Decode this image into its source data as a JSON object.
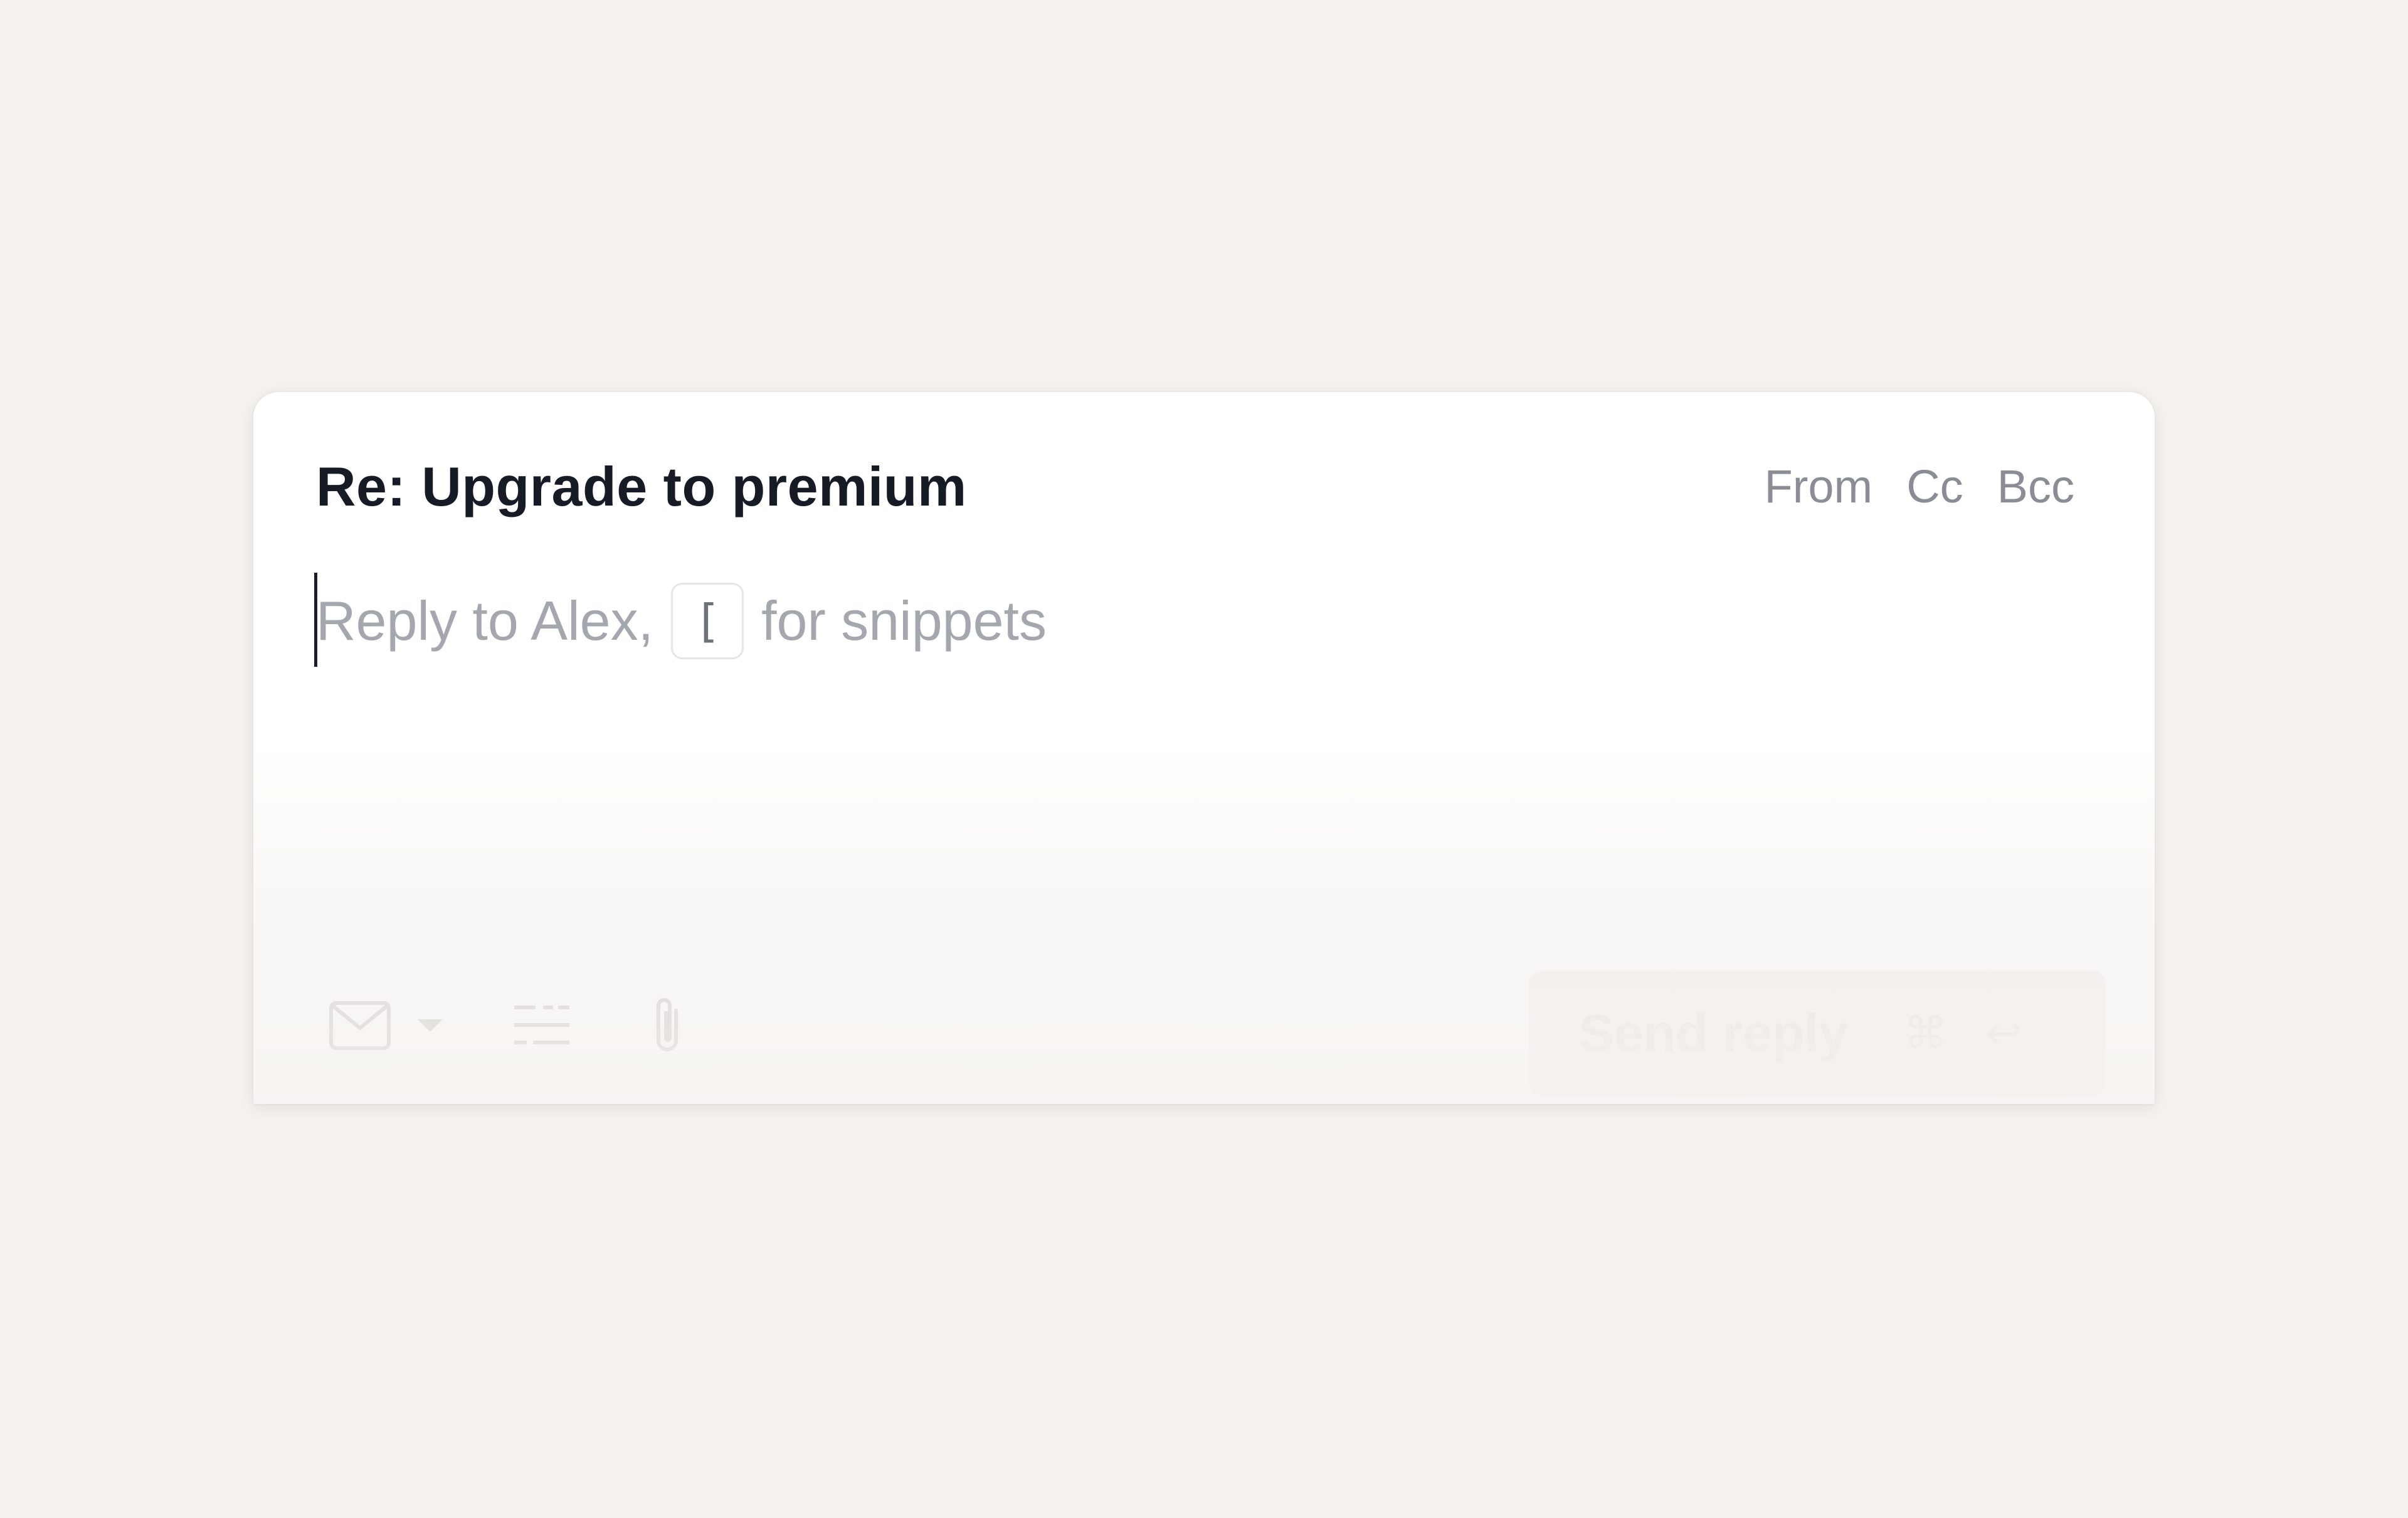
{
  "composer": {
    "subject": "Re: Upgrade to premium",
    "header_links": {
      "from": "From",
      "cc": "Cc",
      "bcc": "Bcc"
    },
    "placeholder": {
      "before": "Reply to Alex,",
      "key": "[",
      "after": "for snippets"
    },
    "toolbar": {
      "icons": [
        "mail-icon",
        "chevron-down-icon",
        "text-format-icon",
        "paperclip-icon"
      ]
    },
    "send": {
      "label": "Send reply",
      "shortcut_mod": "⌘",
      "shortcut_key": "↩"
    }
  },
  "colors": {
    "background": "#f5f2ef",
    "card": "#ffffff",
    "subject_text": "#171b26",
    "muted_text": "#8a8d96",
    "placeholder_text": "#a4a7ae"
  }
}
